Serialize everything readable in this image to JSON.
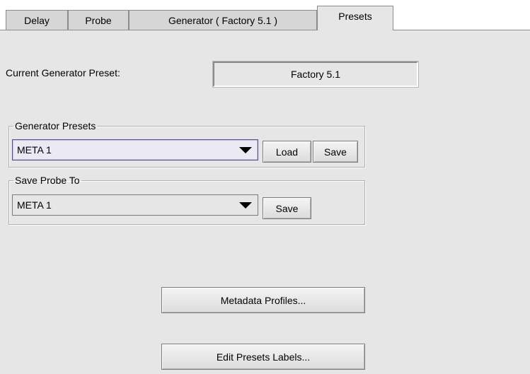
{
  "tabs": [
    {
      "label": "Delay"
    },
    {
      "label": "Probe"
    },
    {
      "label": "Generator ( Factory 5.1 )"
    },
    {
      "label": "Presets"
    }
  ],
  "active_tab": "Presets",
  "current_preset": {
    "label": "Current Generator Preset:",
    "value": "Factory 5.1"
  },
  "generator_presets": {
    "legend": "Generator Presets",
    "selected": "META 1",
    "load_label": "Load",
    "save_label": "Save"
  },
  "save_probe_to": {
    "legend": "Save Probe To",
    "selected": "META 1",
    "save_label": "Save"
  },
  "buttons": {
    "metadata_profiles": "Metadata Profiles...",
    "edit_presets_labels": "Edit Presets Labels..."
  },
  "colors": {
    "panel_bg": "#e6e6e6",
    "tab_bg": "#d6d6d6",
    "border": "#8c8c8c"
  },
  "icons": {
    "dropdown": "triangle-down"
  }
}
